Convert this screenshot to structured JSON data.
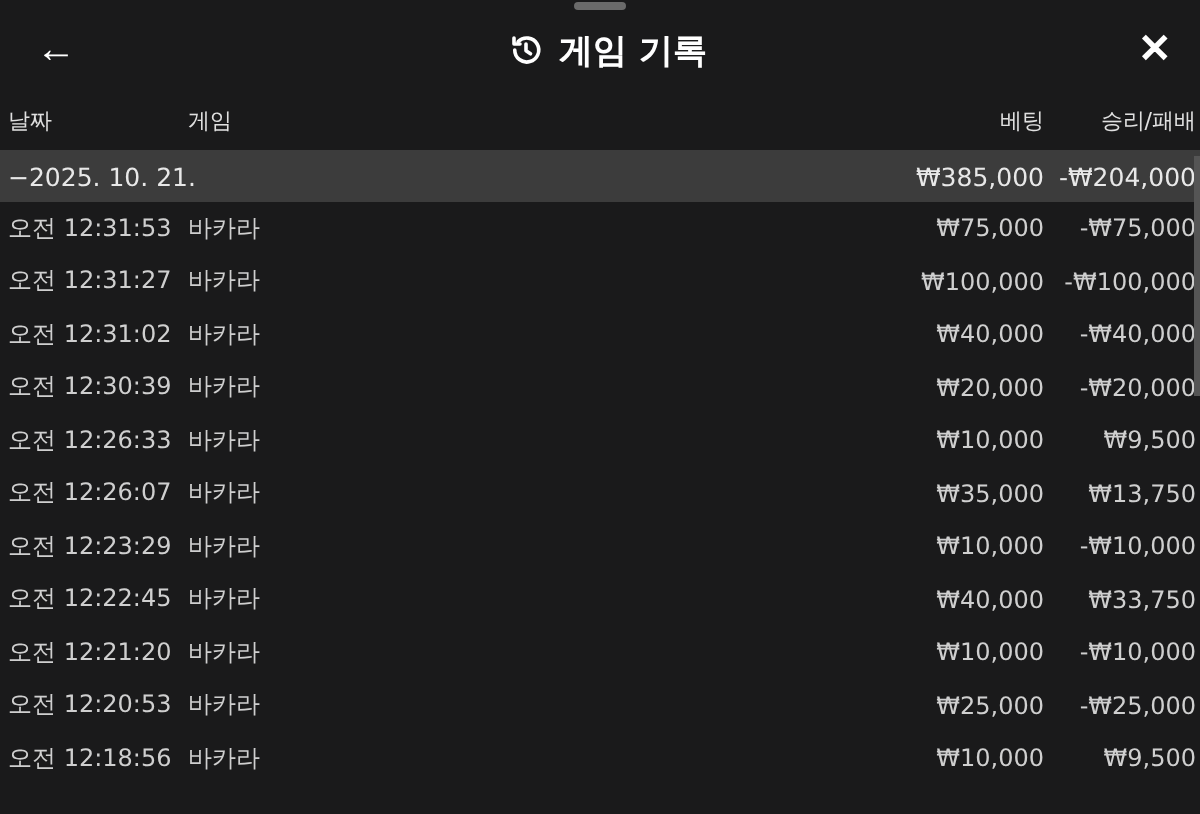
{
  "header": {
    "back": "←",
    "title": "게임 기록",
    "close": "✕"
  },
  "columns": {
    "date": "날짜",
    "game": "게임",
    "bet": "베팅",
    "result": "승리/패배"
  },
  "group": {
    "toggle": "−",
    "date": "2025. 10. 21.",
    "bet": "₩385,000",
    "result": "-₩204,000"
  },
  "rows": [
    {
      "time": "오전 12:31:53",
      "game": "바카라",
      "bet": "₩75,000",
      "result": "-₩75,000"
    },
    {
      "time": "오전 12:31:27",
      "game": "바카라",
      "bet": "₩100,000",
      "result": "-₩100,000"
    },
    {
      "time": "오전 12:31:02",
      "game": "바카라",
      "bet": "₩40,000",
      "result": "-₩40,000"
    },
    {
      "time": "오전 12:30:39",
      "game": "바카라",
      "bet": "₩20,000",
      "result": "-₩20,000"
    },
    {
      "time": "오전 12:26:33",
      "game": "바카라",
      "bet": "₩10,000",
      "result": "₩9,500"
    },
    {
      "time": "오전 12:26:07",
      "game": "바카라",
      "bet": "₩35,000",
      "result": "₩13,750"
    },
    {
      "time": "오전 12:23:29",
      "game": "바카라",
      "bet": "₩10,000",
      "result": "-₩10,000"
    },
    {
      "time": "오전 12:22:45",
      "game": "바카라",
      "bet": "₩40,000",
      "result": "₩33,750"
    },
    {
      "time": "오전 12:21:20",
      "game": "바카라",
      "bet": "₩10,000",
      "result": "-₩10,000"
    },
    {
      "time": "오전 12:20:53",
      "game": "바카라",
      "bet": "₩25,000",
      "result": "-₩25,000"
    },
    {
      "time": "오전 12:18:56",
      "game": "바카라",
      "bet": "₩10,000",
      "result": "₩9,500"
    }
  ]
}
